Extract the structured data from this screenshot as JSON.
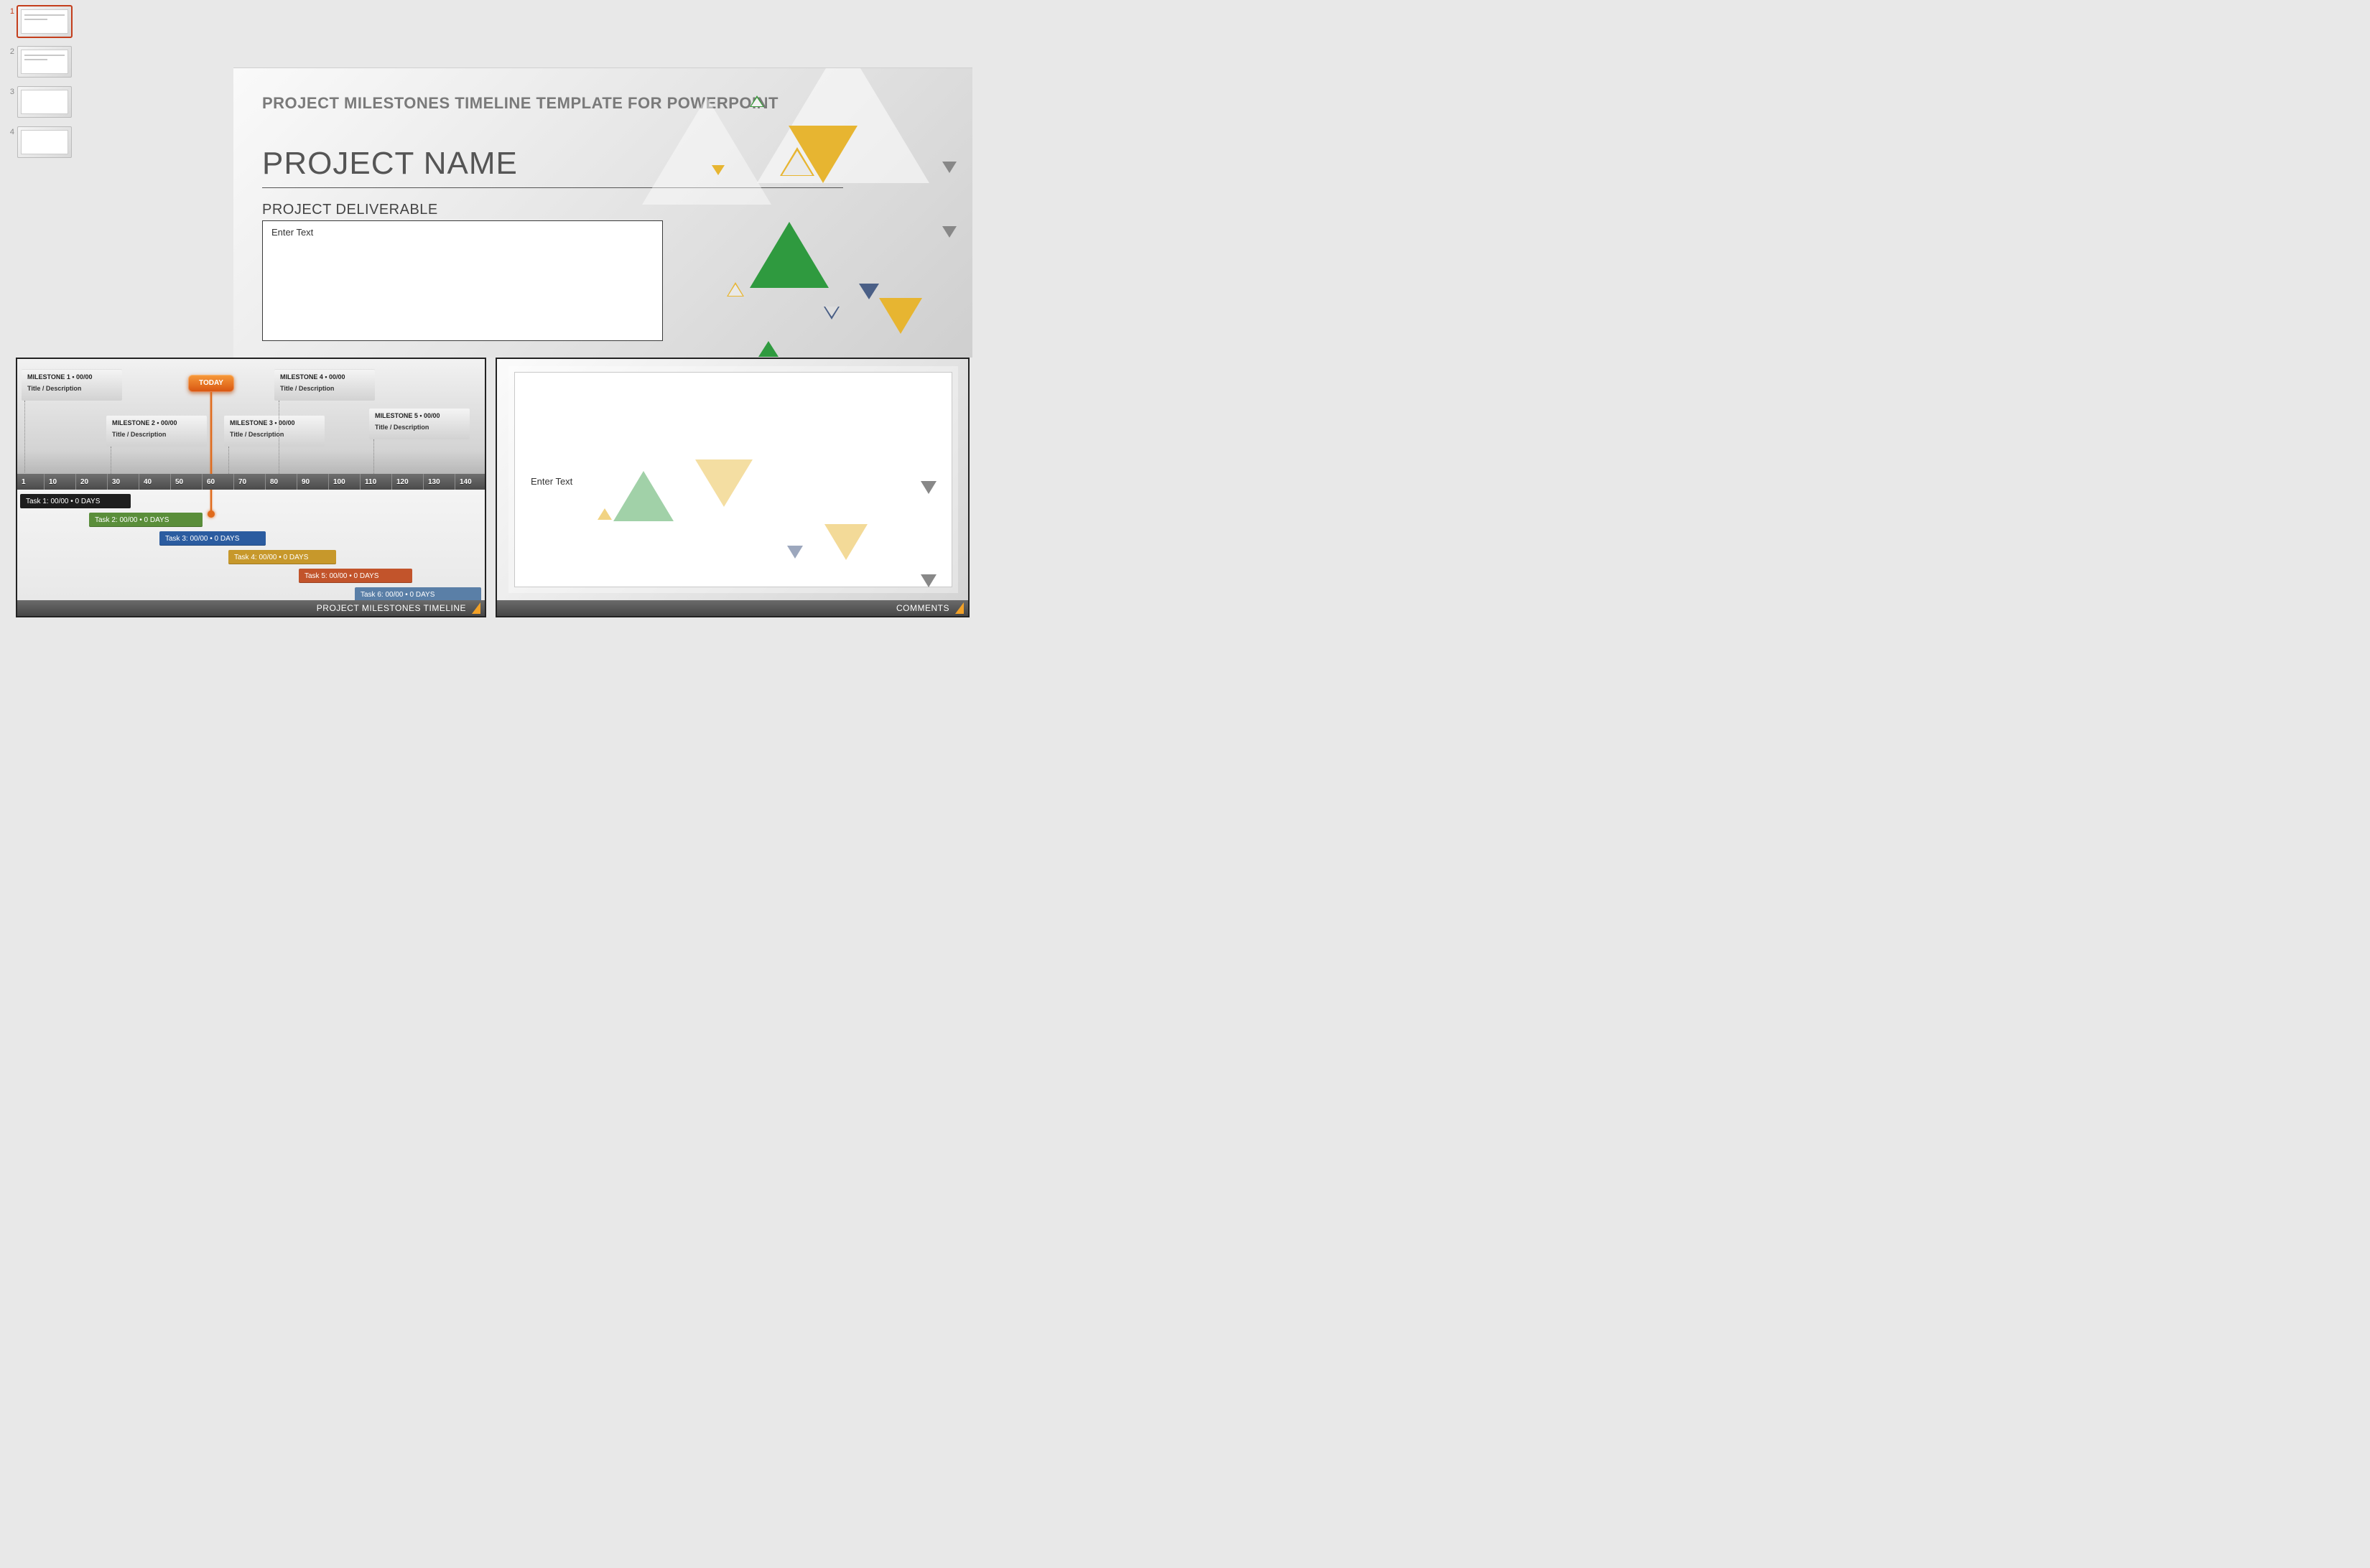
{
  "thumbnails": [
    "1",
    "2",
    "3",
    "4"
  ],
  "activeThumb": 0,
  "slide": {
    "header": "PROJECT MILESTONES TIMELINE TEMPLATE FOR POWERPOINT",
    "projectName": "PROJECT NAME",
    "deliverableLabel": "PROJECT DELIVERABLE",
    "deliverablePlaceholder": "Enter Text"
  },
  "timeline": {
    "caption": "PROJECT MILESTONES TIMELINE",
    "todayLabel": "TODAY",
    "milestones": [
      {
        "title": "MILESTONE 1 • 00/00",
        "desc": "Title / Description"
      },
      {
        "title": "MILESTONE 2 • 00/00",
        "desc": "Title / Description"
      },
      {
        "title": "MILESTONE 3 • 00/00",
        "desc": "Title / Description"
      },
      {
        "title": "MILESTONE 4 • 00/00",
        "desc": "Title / Description"
      },
      {
        "title": "MILESTONE 5 • 00/00",
        "desc": "Title / Description"
      }
    ],
    "axis": [
      "1",
      "10",
      "20",
      "30",
      "40",
      "50",
      "60",
      "70",
      "80",
      "90",
      "100",
      "110",
      "120",
      "130",
      "140"
    ],
    "tasks": [
      {
        "label": "Task 1: 00/00 • 0 DAYS",
        "color": "#1e1e1e"
      },
      {
        "label": "Task 2: 00/00 • 0 DAYS",
        "color": "#5a8e3a"
      },
      {
        "label": "Task 3: 00/00 • 0 DAYS",
        "color": "#2b5ca0"
      },
      {
        "label": "Task 4: 00/00 • 0 DAYS",
        "color": "#c7982b"
      },
      {
        "label": "Task 5: 00/00 • 0 DAYS",
        "color": "#c2542b"
      },
      {
        "label": "Task 6: 00/00 • 0 DAYS",
        "color": "#5a7fa7"
      }
    ]
  },
  "comments": {
    "caption": "COMMENTS",
    "placeholder": "Enter Text"
  }
}
